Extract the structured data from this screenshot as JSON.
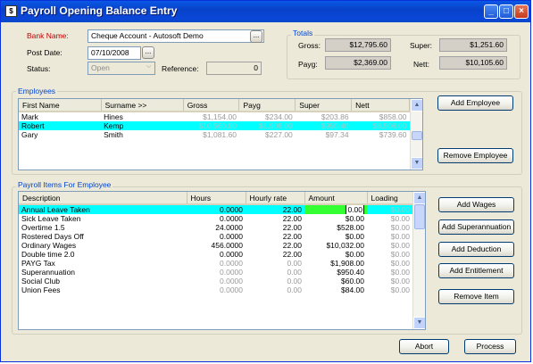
{
  "window": {
    "title": "Payroll Opening Balance Entry"
  },
  "form": {
    "bank_label": "Bank Name:",
    "bank_value": "Cheque Account - Autosoft Demo",
    "post_date_label": "Post Date:",
    "post_date_value": "07/10/2008",
    "status_label": "Status:",
    "status_value": "Open",
    "reference_label": "Reference:",
    "reference_value": "0"
  },
  "totals": {
    "title": "Totals",
    "gross_label": "Gross:",
    "gross_value": "$12,795.60",
    "super_label": "Super:",
    "super_value": "$1,251.60",
    "payg_label": "Payg:",
    "payg_value": "$2,369.00",
    "nett_label": "Nett:",
    "nett_value": "$10,105.60"
  },
  "employees": {
    "title": "Employees",
    "columns": [
      "First Name",
      "Surname >>",
      "Gross",
      "Payg",
      "Super",
      "Nett"
    ],
    "rows": [
      {
        "first": "Mark",
        "surname": "Hines",
        "gross": "$1,154.00",
        "payg": "$234.00",
        "super": "$203.86",
        "nett": "$858.00"
      },
      {
        "first": "Robert",
        "surname": "Kemp",
        "gross": "$10,560.00",
        "payg": "$1,908.00",
        "super": "$950.40",
        "nett": "$8,508.00"
      },
      {
        "first": "Gary",
        "surname": "Smith",
        "gross": "$1,081.60",
        "payg": "$227.00",
        "super": "$97.34",
        "nett": "$739.60"
      }
    ],
    "add_button": "Add Employee",
    "remove_button": "Remove Employee"
  },
  "items": {
    "title": "Payroll Items For Employee",
    "columns": [
      "Description",
      "Hours",
      "Hourly rate",
      "Amount",
      "Loading"
    ],
    "rows": [
      {
        "desc": "Annual Leave Taken",
        "hours": "0.0000",
        "rate": "22.00",
        "amount": "0.00",
        "loading": "$0.00"
      },
      {
        "desc": "Sick Leave Taken",
        "hours": "0.0000",
        "rate": "22.00",
        "amount": "$0.00",
        "loading": "$0.00"
      },
      {
        "desc": "Overtime 1.5",
        "hours": "24.0000",
        "rate": "22.00",
        "amount": "$528.00",
        "loading": "$0.00"
      },
      {
        "desc": "Rostered Days Off",
        "hours": "0.0000",
        "rate": "22.00",
        "amount": "$0.00",
        "loading": "$0.00"
      },
      {
        "desc": "Ordinary Wages",
        "hours": "456.0000",
        "rate": "22.00",
        "amount": "$10,032.00",
        "loading": "$0.00"
      },
      {
        "desc": "Double time 2.0",
        "hours": "0.0000",
        "rate": "22.00",
        "amount": "$0.00",
        "loading": "$0.00"
      },
      {
        "desc": "PAYG Tax",
        "hours": "0.0000",
        "rate": "0.00",
        "amount": "$1,908.00",
        "loading": "$0.00"
      },
      {
        "desc": "Superannuation",
        "hours": "0.0000",
        "rate": "0.00",
        "amount": "$950.40",
        "loading": "$0.00"
      },
      {
        "desc": "Social Club",
        "hours": "0.0000",
        "rate": "0.00",
        "amount": "$60.00",
        "loading": "$0.00"
      },
      {
        "desc": "Union Fees",
        "hours": "0.0000",
        "rate": "0.00",
        "amount": "$84.00",
        "loading": "$0.00"
      }
    ],
    "buttons": {
      "add_wages": "Add Wages",
      "add_super": "Add Superannuation",
      "add_deduction": "Add Deduction",
      "add_entitlement": "Add Entitlement",
      "remove_item": "Remove Item"
    }
  },
  "footer": {
    "abort": "Abort",
    "process": "Process"
  },
  "colors": {
    "selected_row": "#00ffff",
    "edit_cell": "#33ff33",
    "title_blue": "#0842c8",
    "group_label": "#0046d5"
  }
}
